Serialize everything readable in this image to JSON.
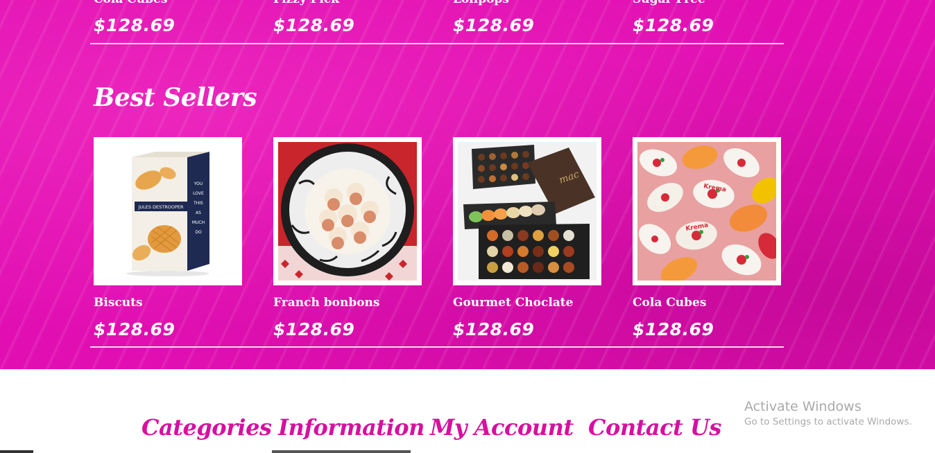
{
  "top_products": [
    {
      "name": "Cola Cubes",
      "price": "$128.69"
    },
    {
      "name": "Fizzy Pick",
      "price": "$128.69"
    },
    {
      "name": "Lolipops",
      "price": "$128.69"
    },
    {
      "name": "Sugar Free",
      "price": "$128.69"
    }
  ],
  "best_sellers": {
    "title": "Best Sellers",
    "products": [
      {
        "name": "Biscuts",
        "price": "$128.69",
        "image": "jules-destrooper-butter-crisps-box"
      },
      {
        "name": "Franch bonbons",
        "price": "$128.69",
        "image": "meringue-bonbons-on-plate"
      },
      {
        "name": "Gourmet Choclate",
        "price": "$128.69",
        "image": "chocolate-and-macaron-gift-box"
      },
      {
        "name": "Cola Cubes",
        "price": "$128.69",
        "image": "wrapped-candies-pile"
      }
    ]
  },
  "footer": {
    "headings": [
      "Categories",
      "Information",
      "My Account",
      "Contact Us"
    ]
  },
  "watermark": {
    "title": "Activate Windows",
    "subtitle": "Go to Settings to activate Windows."
  },
  "colors": {
    "background_pink": "#e10fb2",
    "footer_heading": "#d6109f",
    "text_white": "#ffffff"
  }
}
